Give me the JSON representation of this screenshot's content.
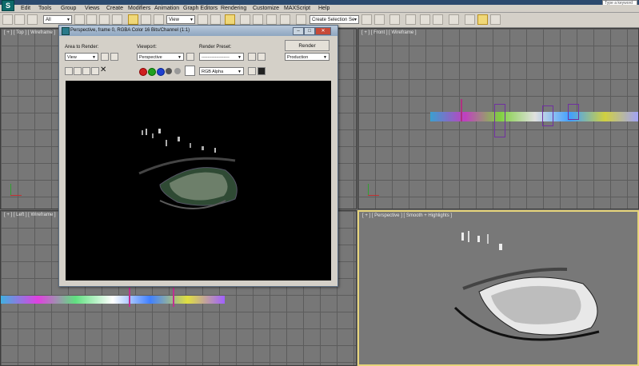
{
  "app": {
    "icon_letter": "S",
    "search_text": "Type a keyword"
  },
  "menu": [
    "Edit",
    "Tools",
    "Group",
    "Views",
    "Create",
    "Modifiers",
    "Animation",
    "Graph Editors",
    "Rendering",
    "Customize",
    "MAXScript",
    "Help"
  ],
  "toolbar": {
    "filter_value": "All",
    "refcoord_value": "View",
    "selection_set_placeholder": "Create Selection Se"
  },
  "viewports": {
    "top": "[ + ] [ Top ] [ Wireframe ]",
    "front": "[ + ] [ Front ] [ Wireframe ]",
    "left": "[ + ] [ Left ] [ Wireframe ]",
    "perspective": "[ + ] [ Perspective ] [ Smooth + Highlights ]"
  },
  "render_window": {
    "title": "Perspective, frame 0, RGBA Color 16 Bits/Channel (1:1)",
    "area_label": "Area to Render:",
    "area_value": "View",
    "viewport_label": "Viewport:",
    "viewport_value": "Perspective",
    "preset_label": "Render Preset:",
    "preset_value": "-------------------",
    "render_button": "Render",
    "production_value": "Production",
    "channel_value": "RGB Alpha"
  },
  "colors": {
    "active_border": "#e6d47a",
    "render_bg": "#000000",
    "red_channel": "#d02020",
    "green_channel": "#20a020",
    "blue_channel": "#2040d0"
  }
}
